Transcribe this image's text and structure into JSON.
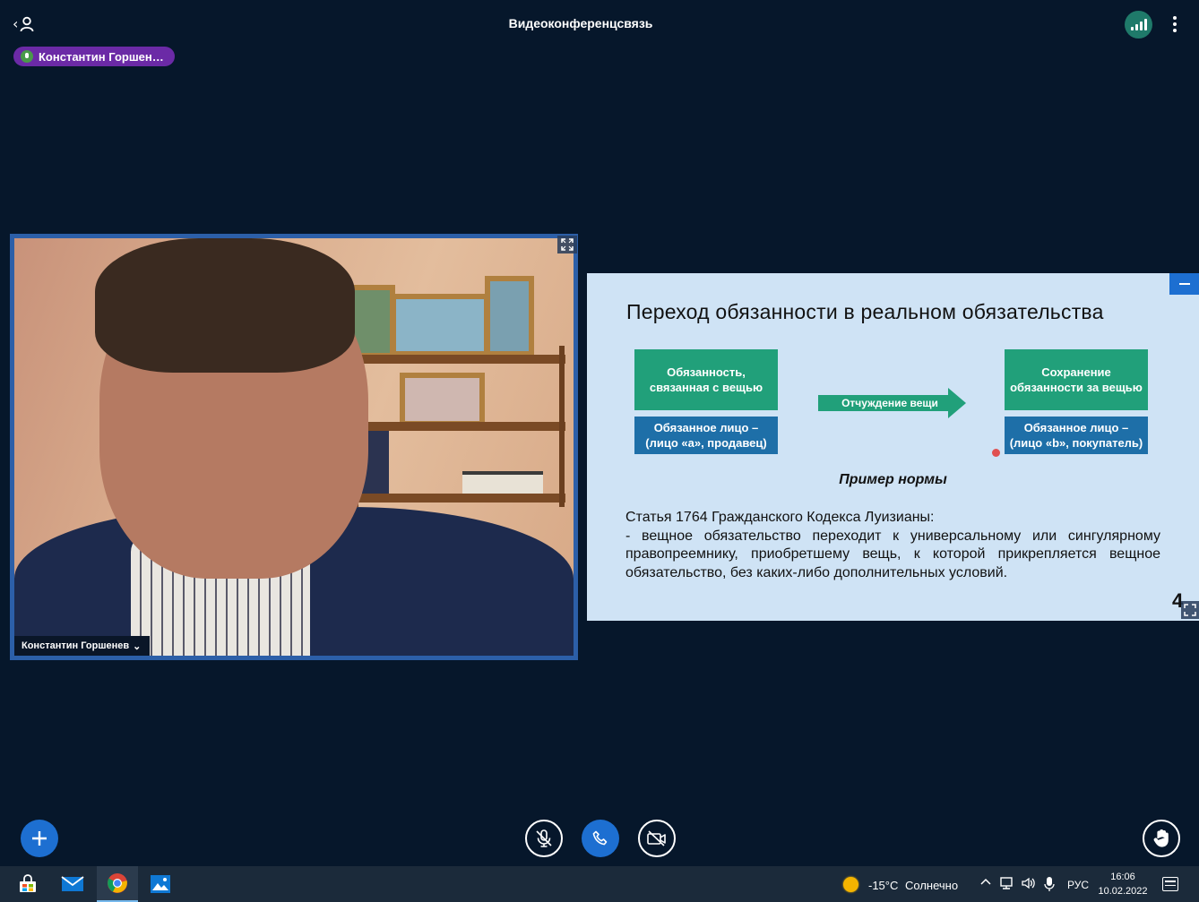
{
  "header": {
    "title": "Видеоконференцсвязь",
    "users_icon": "users-icon",
    "connection_icon": "connection-status-icon",
    "more_icon": "more-vertical-icon"
  },
  "talking_indicator": {
    "name": "Константин Горшен…",
    "icon": "microphone-icon",
    "color": "#6b2aa6"
  },
  "webcam": {
    "participant_name": "Константин Горшенев",
    "dropdown_glyph": "⌄",
    "expand_icon": "fullscreen-icon"
  },
  "presentation": {
    "title": "Переход обязанности в реальном обязательства",
    "left_box_top": "Обязанность,\nсвязанная с вещью",
    "left_box_bottom": "Обязанное лицо –\n(лицо «а», продавец)",
    "arrow_label": "Отчуждение вещи",
    "right_box_top": "Сохранение\nобязанности за вещью",
    "right_box_bottom": "Обязанное лицо –\n(лицо «b», покупатель)",
    "example_heading": "Пример нормы",
    "article_title": "Статья 1764 Гражданского Кодекса Луизианы:",
    "article_text": "- вещное обязательство переходит к универсальному или сингулярному правопреемнику, приобретшему вещь, к которой прикрепляется вещное обязательство, без каких-либо дополнительных условий.",
    "page_number": "4",
    "green": "#21a07a",
    "blue": "#1e6fa8",
    "background": "#cfe3f5"
  },
  "controls": {
    "actions_icon": "plus-icon",
    "mic_icon": "microphone-muted-icon",
    "leave_icon": "phone-icon",
    "camera_icon": "camera-off-icon",
    "raise_hand_icon": "hand-icon",
    "accent": "#1d6fd1"
  },
  "taskbar": {
    "apps": [
      "start-icon",
      "mail-icon",
      "chrome-icon",
      "photos-icon"
    ],
    "weather_temp": "-15°C",
    "weather_text": "Солнечно",
    "language": "РУС",
    "time": "16:06",
    "date": "10.02.2022"
  }
}
